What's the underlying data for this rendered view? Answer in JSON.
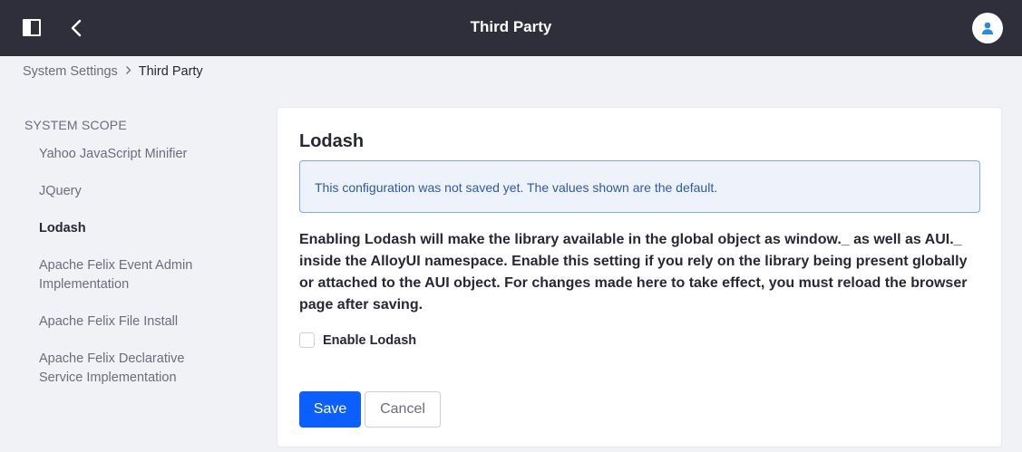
{
  "header": {
    "title": "Third Party",
    "icons": {
      "panel_toggle": "product-menu-icon",
      "back": "angle-left-icon",
      "user": "user-avatar-icon"
    },
    "background": "#2e2f3a"
  },
  "breadcrumb": {
    "items": [
      "System Settings",
      "Third Party"
    ]
  },
  "sidebar": {
    "section_title": "SYSTEM SCOPE",
    "items": [
      {
        "label": "Yahoo JavaScript Minifier",
        "active": false
      },
      {
        "label": "JQuery",
        "active": false
      },
      {
        "label": "Lodash",
        "active": true
      },
      {
        "label": "Apache Felix Event Admin Implementation",
        "active": false
      },
      {
        "label": "Apache Felix File Install",
        "active": false
      },
      {
        "label": "Apache Felix Declarative Service Implementation",
        "active": false
      }
    ]
  },
  "main": {
    "title": "Lodash",
    "alert": "This configuration was not saved yet. The values shown are the default.",
    "description": "Enabling Lodash will make the library available in the global object as window._ as well as AUI._ inside the AlloyUI namespace. Enable this setting if you rely on the library being present globally or attached to the AUI object. For changes made here to take effect, you must reload the browser page after saving.",
    "checkbox": {
      "label": "Enable Lodash",
      "checked": false
    },
    "save_label": "Save",
    "cancel_label": "Cancel"
  },
  "colors": {
    "primary": "#0b5fff",
    "alert_bg": "#eef2fa",
    "alert_text": "#2e5aac"
  }
}
